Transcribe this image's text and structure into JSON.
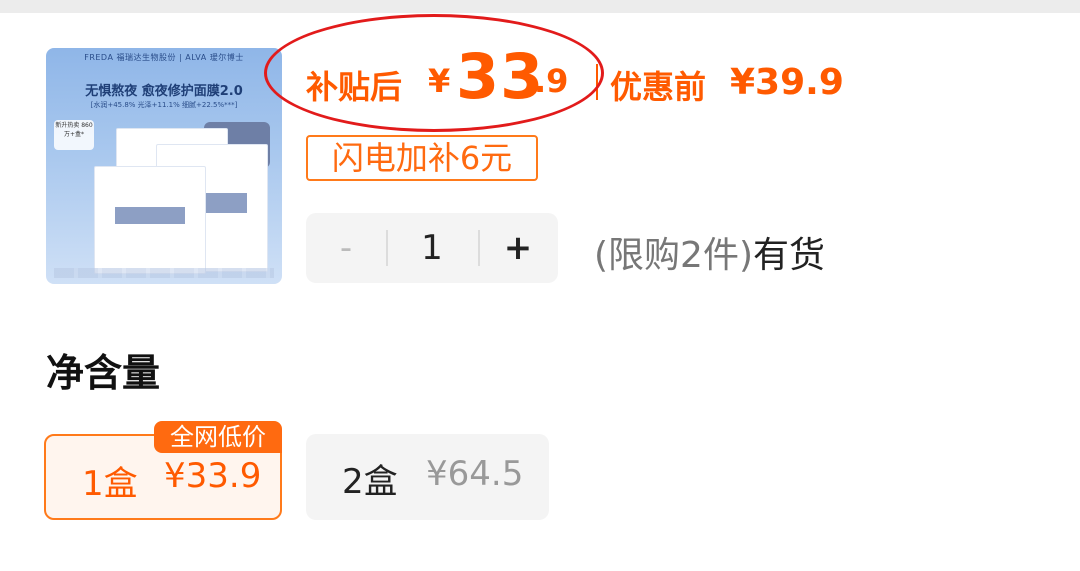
{
  "product": {
    "image_brand": "FREDA 福瑞达生物股份 | ALVA 瑷尔博士",
    "image_title": "无惧熬夜 愈夜修护面膜2.0",
    "image_sub": "[水润+45.8% 光泽+11.1% 细腻+22.5%***]",
    "image_badge": "新升热卖 860万+盒*",
    "image_pack_brand": "ALVA"
  },
  "price": {
    "subsidy_label": "补贴后",
    "currency": "¥",
    "integer": "33",
    "decimal": ".9",
    "original_label": "优惠前",
    "original_price": "¥39.9"
  },
  "promo": {
    "flash_tag": "闪电加补6元"
  },
  "quantity": {
    "minus": "-",
    "value": "1",
    "plus": "+",
    "limit_text": "(限购2件)",
    "stock_text": "有货"
  },
  "net_content": {
    "title": "净含量",
    "options": [
      {
        "name": "1盒",
        "price": "¥33.9",
        "tag": "全网低价",
        "selected": true
      },
      {
        "name": "2盒",
        "price": "¥64.5",
        "selected": false
      }
    ]
  },
  "colors": {
    "accent": "#ff5a00",
    "annotation": "#e21b1b"
  }
}
